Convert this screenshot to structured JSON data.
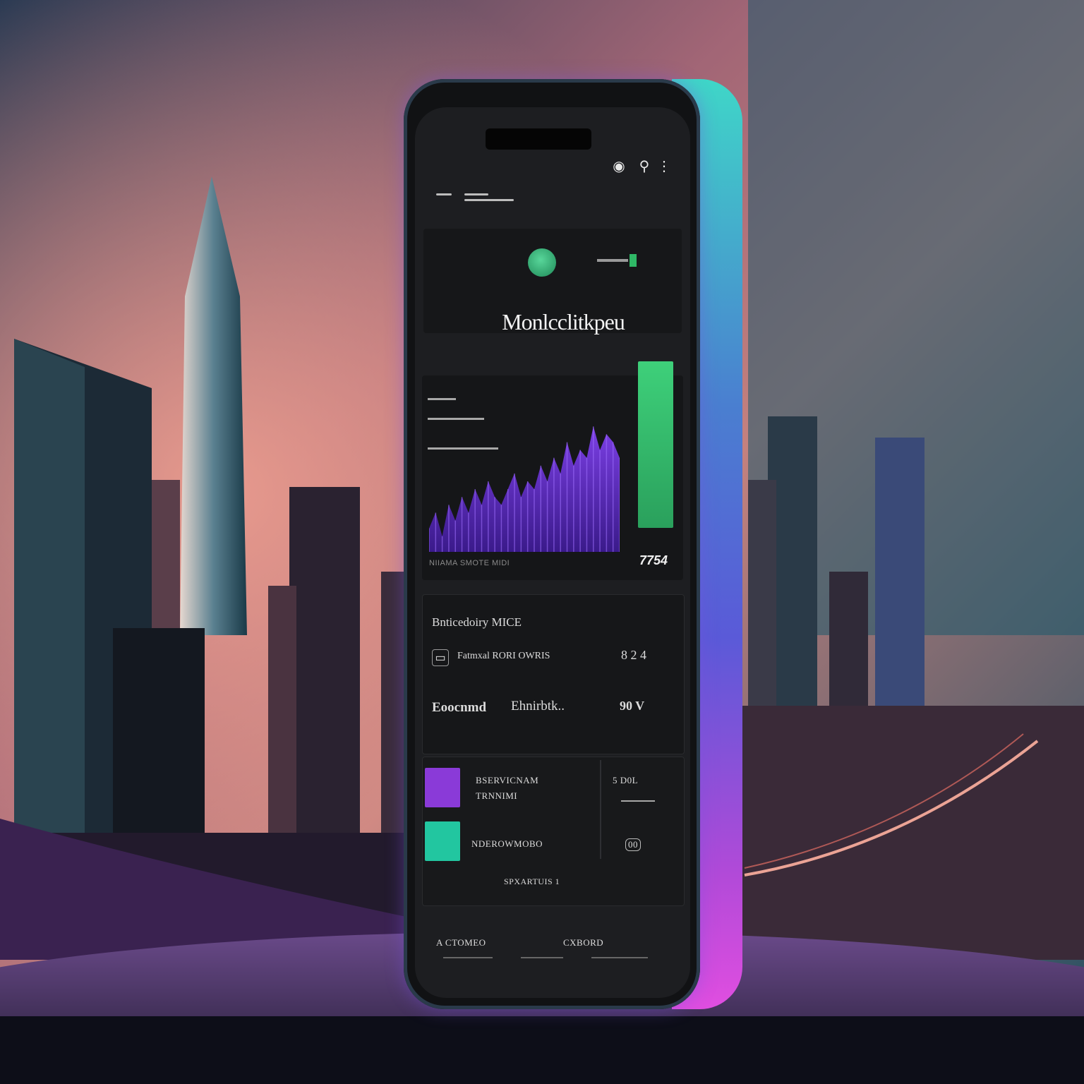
{
  "app": {
    "title": "Monlcclitkpeu"
  },
  "status_bar": {
    "icons": [
      "record-icon",
      "pin-icon",
      "options-icon"
    ]
  },
  "chart": {
    "value_label": "7754",
    "footer_label": "NIIAMA SMOTE MIDI"
  },
  "chart_data": {
    "type": "area",
    "series": [
      {
        "values": [
          3,
          5,
          2,
          6,
          4,
          7,
          5,
          8,
          6,
          9,
          7,
          6,
          8,
          10,
          7,
          9,
          8,
          11,
          9,
          12,
          10,
          14,
          11,
          13,
          12,
          16,
          13,
          15,
          14,
          12
        ]
      }
    ],
    "ylim": [
      0,
      18
    ],
    "colors": [
      "#7b3fe4",
      "#3a1a8a"
    ]
  },
  "list": {
    "heading": "Bnticedoiry MICE",
    "row1_label": "Fatmxal RORI OWRIS",
    "row1_value": "8 2 4",
    "row2_left": "Eoocnmd",
    "row2_mid": "Ehnirbtk..",
    "row2_value": "90 V"
  },
  "bottom": {
    "item1_label": "BSERVICNAM",
    "item1_sub": "TRNNIMI",
    "item1_value": "5 D0L",
    "item2_label": "NDEROWMOBO",
    "item2_value": "00",
    "caption": "SPXARTUIS 1",
    "colors": {
      "purple": "#8a3ad8",
      "teal": "#22c6a0"
    }
  },
  "footer": {
    "left_label": "A CTOMEO",
    "right_label": "CXBORD"
  }
}
